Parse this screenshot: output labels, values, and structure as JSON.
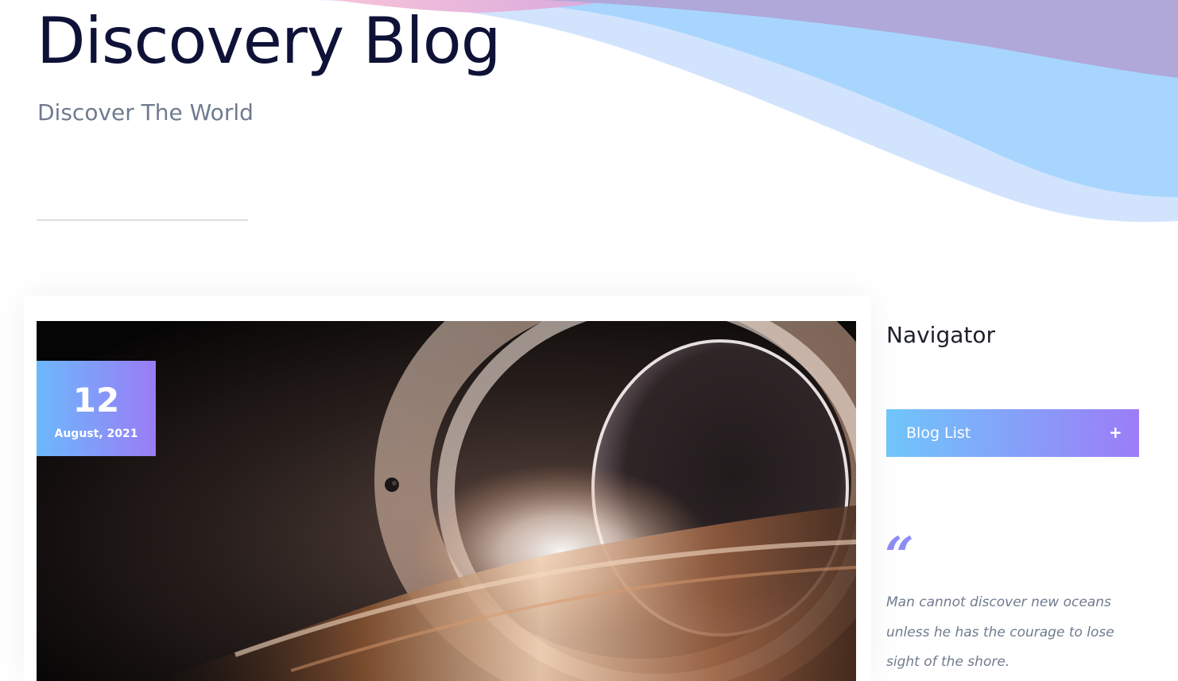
{
  "header": {
    "title": "Discovery Blog",
    "subtitle": "Discover The World"
  },
  "post": {
    "date_day": "12",
    "date_month": "August, 2021",
    "image": "black-hole-image"
  },
  "sidebar": {
    "heading": "Navigator",
    "menu_button_label": "Blog List",
    "menu_button_icon": "+",
    "quote_mark": "“",
    "quote": "Man cannot discover new oceans unless he has the courage to lose sight of the shore."
  },
  "colors": {
    "title": "#0f1237",
    "muted_text": "#6f7b8e",
    "gradient_start": "#6cb8fb",
    "gradient_end": "#9a7cf6",
    "quote_mark": "#8e8cf4"
  }
}
